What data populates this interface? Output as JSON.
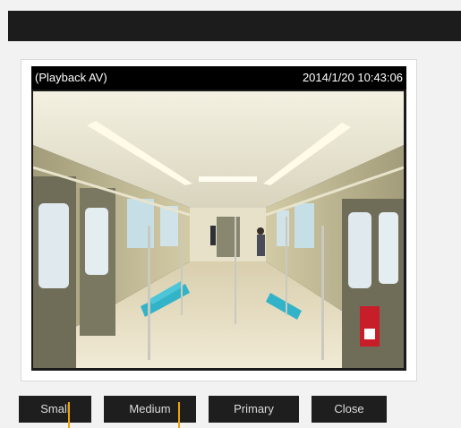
{
  "overlay": {
    "mode_label": "(Playback AV)",
    "timestamp": "2014/1/20 10:43:06"
  },
  "buttons": {
    "small": "Small",
    "medium": "Medium",
    "primary": "Primary",
    "close": "Close"
  },
  "colors": {
    "topbar": "#1c1c1c",
    "button_bg": "#1e1e1e",
    "button_text": "#dcdcdc",
    "accent_marker": "#f0a500"
  }
}
